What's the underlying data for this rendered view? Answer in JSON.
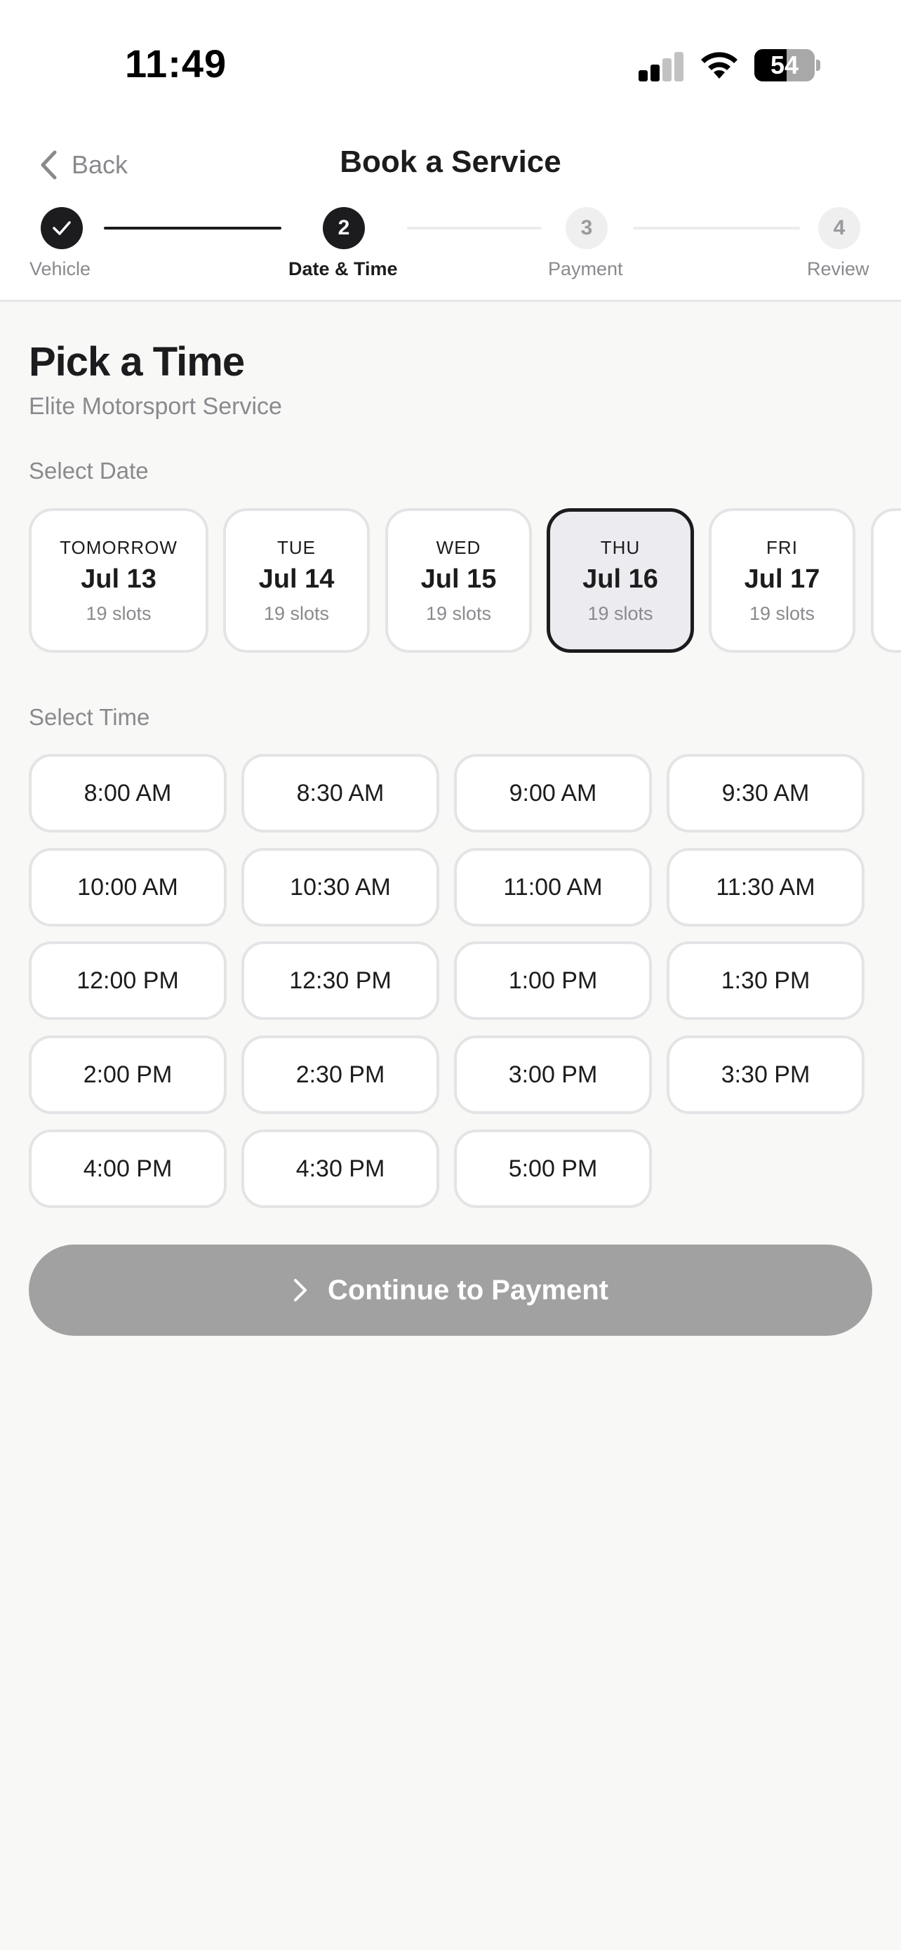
{
  "status_bar": {
    "time": "11:49",
    "battery_percent": "54"
  },
  "nav": {
    "back_label": "Back",
    "title": "Book a Service"
  },
  "stepper": {
    "steps": [
      {
        "number": "1",
        "label": "Vehicle",
        "state": "done"
      },
      {
        "number": "2",
        "label": "Date & Time",
        "state": "active"
      },
      {
        "number": "3",
        "label": "Payment",
        "state": "todo"
      },
      {
        "number": "4",
        "label": "Review",
        "state": "todo"
      }
    ]
  },
  "page": {
    "title": "Pick a Time",
    "subtitle": "Elite Motorsport Service",
    "date_section_label": "Select Date",
    "time_section_label": "Select Time"
  },
  "dates": [
    {
      "dow": "TOMORROW",
      "day": "Jul 13",
      "slots": "19 slots"
    },
    {
      "dow": "TUE",
      "day": "Jul 14",
      "slots": "19 slots"
    },
    {
      "dow": "WED",
      "day": "Jul 15",
      "slots": "19 slots"
    },
    {
      "dow": "THU",
      "day": "Jul 16",
      "slots": "19 slots",
      "selected": true
    },
    {
      "dow": "FRI",
      "day": "Jul 17",
      "slots": "19 slots"
    }
  ],
  "times": [
    "8:00 AM",
    "8:30 AM",
    "9:00 AM",
    "9:30 AM",
    "10:00 AM",
    "10:30 AM",
    "11:00 AM",
    "11:30 AM",
    "12:00 PM",
    "12:30 PM",
    "1:00 PM",
    "1:30 PM",
    "2:00 PM",
    "2:30 PM",
    "3:00 PM",
    "3:30 PM",
    "4:00 PM",
    "4:30 PM",
    "5:00 PM"
  ],
  "cta": {
    "label": "Continue to Payment",
    "enabled": false
  },
  "colors": {
    "accent": "#1c1c1e",
    "cta_disabled": "#a1a1a1",
    "background": "#f8f8f7"
  }
}
